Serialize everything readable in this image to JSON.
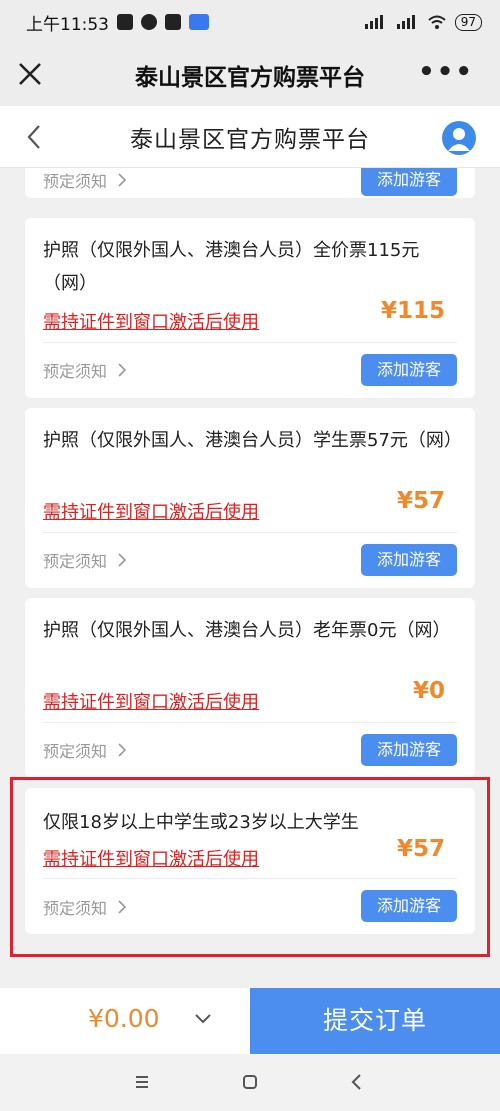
{
  "status_bar": {
    "time": "上午11:53",
    "battery": "97"
  },
  "wechat_bar": {
    "title": "泰山景区官方购票平台",
    "more_label": "•••"
  },
  "header": {
    "title": "泰山景区官方购票平台"
  },
  "top_card": {
    "notice_label": "预定须知",
    "add_label": "添加游客"
  },
  "tickets": [
    {
      "name": "护照（仅限外国人、港澳台人员）全价票115元（网）",
      "warning": "需持证件到窗口激活后使用",
      "price": "¥115",
      "notice_label": "预定须知",
      "add_label": "添加游客"
    },
    {
      "name": "护照（仅限外国人、港澳台人员）学生票57元（网）",
      "warning": "需持证件到窗口激活后使用",
      "price": "¥57",
      "notice_label": "预定须知",
      "add_label": "添加游客"
    },
    {
      "name": "护照（仅限外国人、港澳台人员）老年票0元（网）",
      "warning": "需持证件到窗口激活后使用",
      "price": "¥0",
      "notice_label": "预定须知",
      "add_label": "添加游客"
    },
    {
      "name": "仅限18岁以上中学生或23岁以上大学生",
      "warning": "需持证件到窗口激活后使用",
      "price": "¥57",
      "notice_label": "预定须知",
      "add_label": "添加游客"
    }
  ],
  "bottom_bar": {
    "total": "¥0.00",
    "submit_label": "提交订单"
  },
  "colors": {
    "accent": "#4c8ef0",
    "price": "#f0892d",
    "warning": "#e02020",
    "highlight": "#e0202a"
  }
}
